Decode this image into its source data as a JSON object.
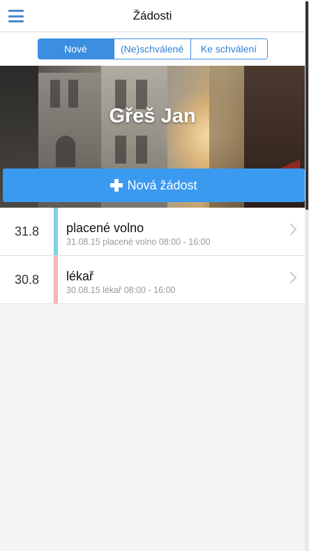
{
  "header": {
    "title": "Žádosti",
    "menu_icon": "hamburger-icon"
  },
  "tabs": [
    {
      "label": "Nové",
      "active": true
    },
    {
      "label": "(Ne)schválené",
      "active": false
    },
    {
      "label": "Ke schválení",
      "active": false
    }
  ],
  "hero": {
    "user_name": "Gřeš Jan",
    "new_request_label": "Nová žádost",
    "new_request_icon": "plus-icon"
  },
  "requests": [
    {
      "date": "31.8",
      "type": "placené volno",
      "detail": "31.08.15 placené volno 08:00 - 16:00",
      "color": "#7fd2e6"
    },
    {
      "date": "30.8",
      "type": "lékař",
      "detail": "30.08.15 lékař 08:00 - 16:00",
      "color": "#f4b6b0"
    }
  ],
  "colors": {
    "accent": "#3b8ee0",
    "button": "#3a9af0"
  }
}
